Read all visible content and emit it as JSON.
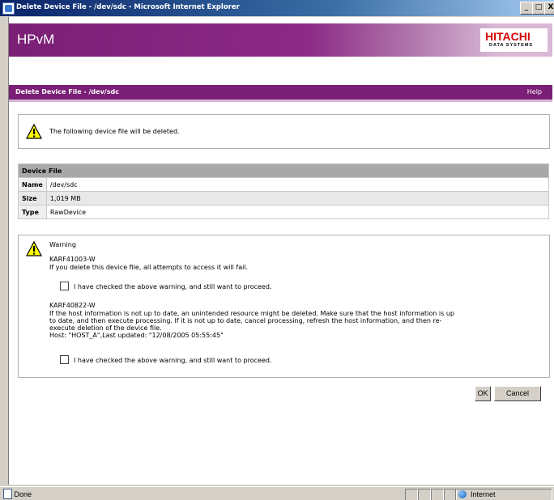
{
  "window": {
    "title": "Delete Device File - /dev/sdc - Microsoft Internet Explorer",
    "buttons": [
      "_",
      "□",
      "X"
    ]
  },
  "header": {
    "app_name": "HPvM",
    "logo_main": "HITACHI",
    "logo_sub": "DATA SYSTEMS"
  },
  "subbar": {
    "title": "Delete Device File - /dev/sdc",
    "help": "Help"
  },
  "message": {
    "text": "The following device file will be deleted."
  },
  "device_table": {
    "header": "Device File",
    "rows": [
      {
        "label": "Name",
        "value": "/dev/sdc"
      },
      {
        "label": "Size",
        "value": "1,019 MB"
      },
      {
        "label": "Type",
        "value": "RawDevice"
      }
    ]
  },
  "warning": {
    "title": "Warning",
    "code1": "KARF41003-W",
    "msg1": "If you delete this device file, all attempts to access it will fail.",
    "check1": "I have checked the above warning, and still want to proceed.",
    "code2": "KARF40822-W",
    "msg2_line1": "If the host information is not up to date, an unintended resource might be deleted. Make sure that the host information is up",
    "msg2_line2": "to date, and then execute processing. If it is not up to date, cancel processing, refresh the host information, and then re-",
    "msg2_line3": "execute deletion of the device file.",
    "host_line": "Host: \"HOST_A\",Last updated: \"12/08/2005 05:55:45\"",
    "check2": "I have checked the above warning, and still want to proceed."
  },
  "buttons": {
    "ok": "OK",
    "cancel": "Cancel"
  },
  "status": {
    "text": "Done",
    "zone": "Internet"
  }
}
